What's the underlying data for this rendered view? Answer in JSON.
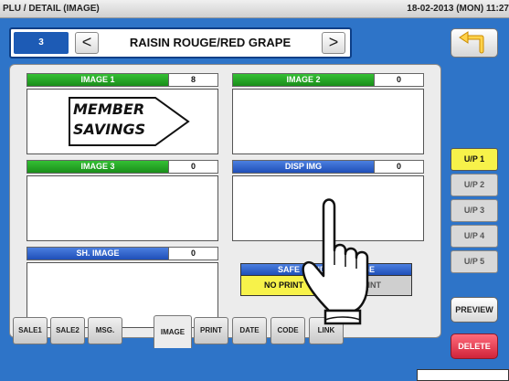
{
  "titlebar": {
    "title": "PLU / DETAIL (IMAGE)",
    "datetime": "18-02-2013 (MON) 11:27"
  },
  "nav": {
    "plu_number": "3",
    "prev": "<",
    "next": ">",
    "plu_name": "RAISIN ROUGE/RED GRAPE"
  },
  "images": [
    {
      "label": "IMAGE 1",
      "value": "8",
      "content_line1": "MEMBER",
      "content_line2": "SAVINGS"
    },
    {
      "label": "IMAGE 2",
      "value": "0"
    },
    {
      "label": "IMAGE 3",
      "value": "0"
    },
    {
      "label": "DISP IMG",
      "value": "0"
    },
    {
      "label": "SH. IMAGE",
      "value": "0"
    }
  ],
  "safe_handling": {
    "label": "SAFE HANDLING IMAGE",
    "options": [
      "NO PRINT",
      "PRINT"
    ],
    "selected": "NO PRINT"
  },
  "side": {
    "pages": [
      "U/P 1",
      "U/P 2",
      "U/P 3",
      "U/P 4",
      "U/P 5"
    ],
    "selected_page": "U/P 1",
    "preview": "PREVIEW",
    "delete": "DELETE"
  },
  "tabs": [
    "SALE1",
    "SALE2",
    "MSG.",
    "IMAGE",
    "PRINT",
    "DATE",
    "CODE",
    "LINK"
  ],
  "active_tab": "IMAGE",
  "colors": {
    "background": "#2e74c8",
    "green_label": "#1a8e1a",
    "blue_label": "#1f4fb8",
    "selected": "#f7f24a",
    "delete": "#d0233a"
  }
}
